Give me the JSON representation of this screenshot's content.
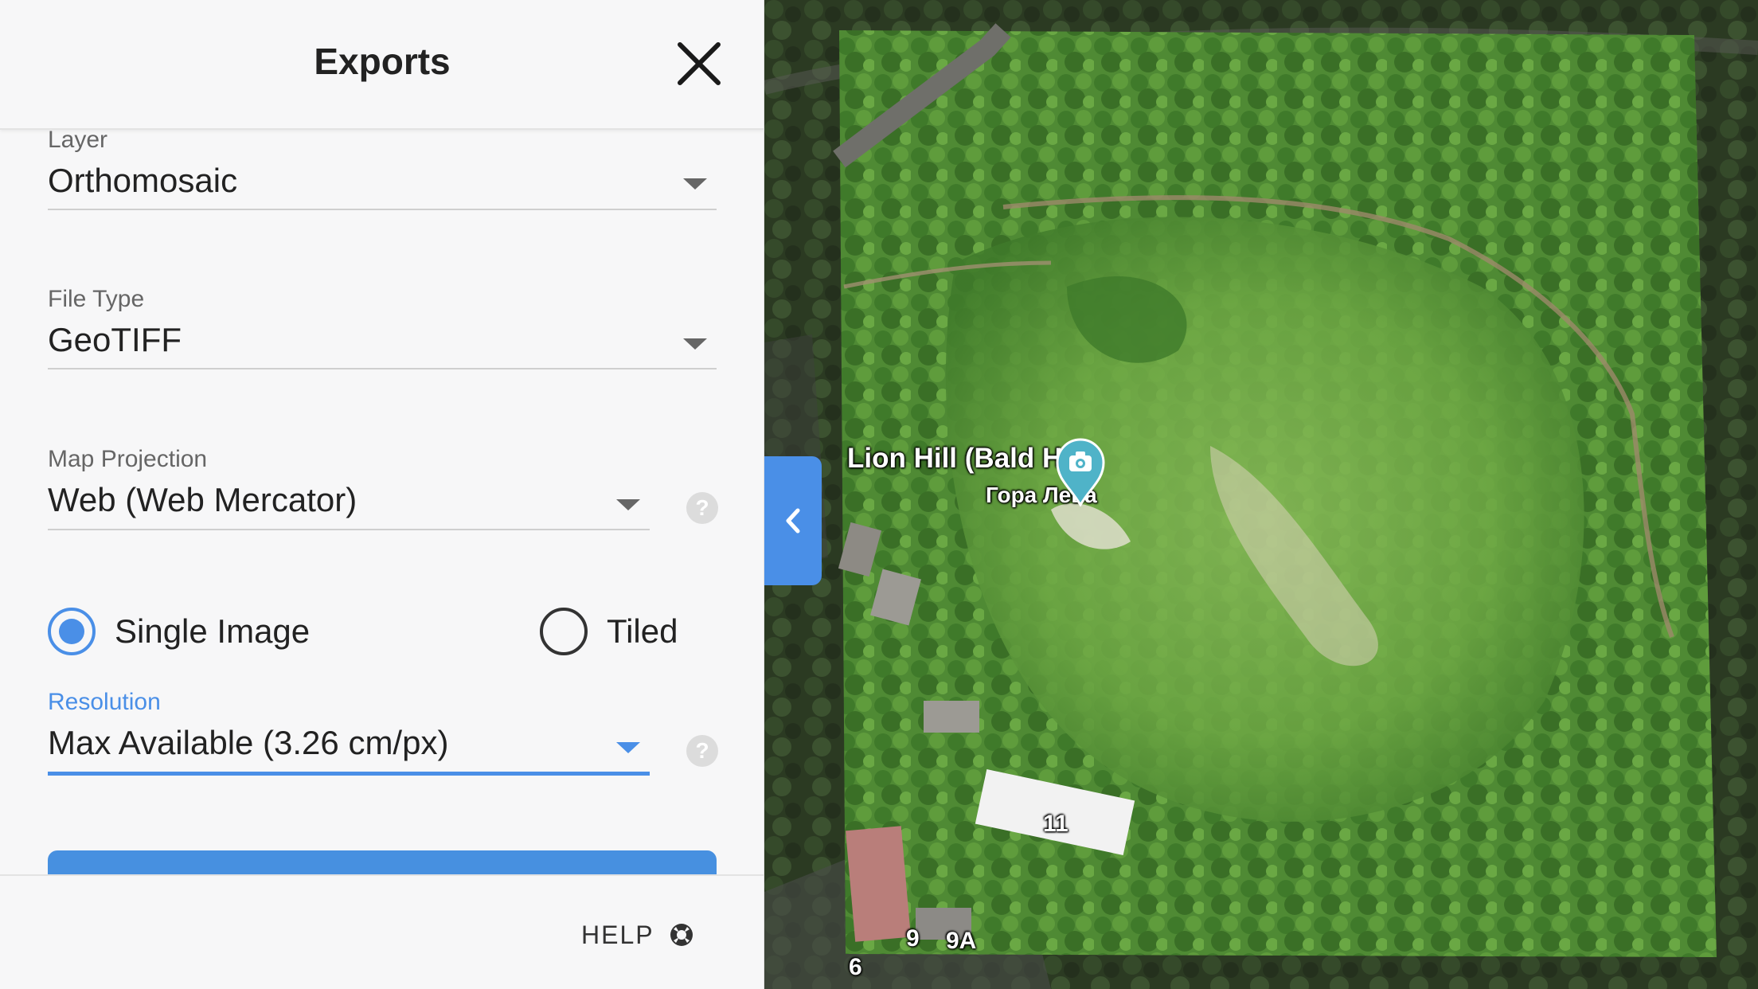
{
  "panel": {
    "title": "Exports",
    "layer": {
      "label": "Layer",
      "value": "Orthomosaic"
    },
    "file_type": {
      "label": "File Type",
      "value": "GeoTIFF"
    },
    "projection": {
      "label": "Map Projection",
      "value": "Web (Web Mercator)",
      "help": "?"
    },
    "output_mode": {
      "options": [
        {
          "label": "Single Image",
          "selected": true
        },
        {
          "label": "Tiled",
          "selected": false
        }
      ]
    },
    "resolution": {
      "label": "Resolution",
      "value": "Max Available (3.26 cm/px)",
      "help": "?"
    },
    "footer": {
      "help_label": "HELP",
      "help_icon": "lifebuoy-icon"
    }
  },
  "map": {
    "place_name": "Lion Hill (Bald Hill)",
    "place_name_local": "Гора Лева",
    "place_icon": "camera-pin-icon",
    "building_numbers": [
      "11",
      "9",
      "9A",
      "6"
    ],
    "collapse_icon": "chevron-left-icon"
  },
  "colors": {
    "accent": "#4a8fe7",
    "text": "#222222",
    "muted": "#666666",
    "panel_bg": "#f7f7f8",
    "pin": "#4fb3c8"
  }
}
